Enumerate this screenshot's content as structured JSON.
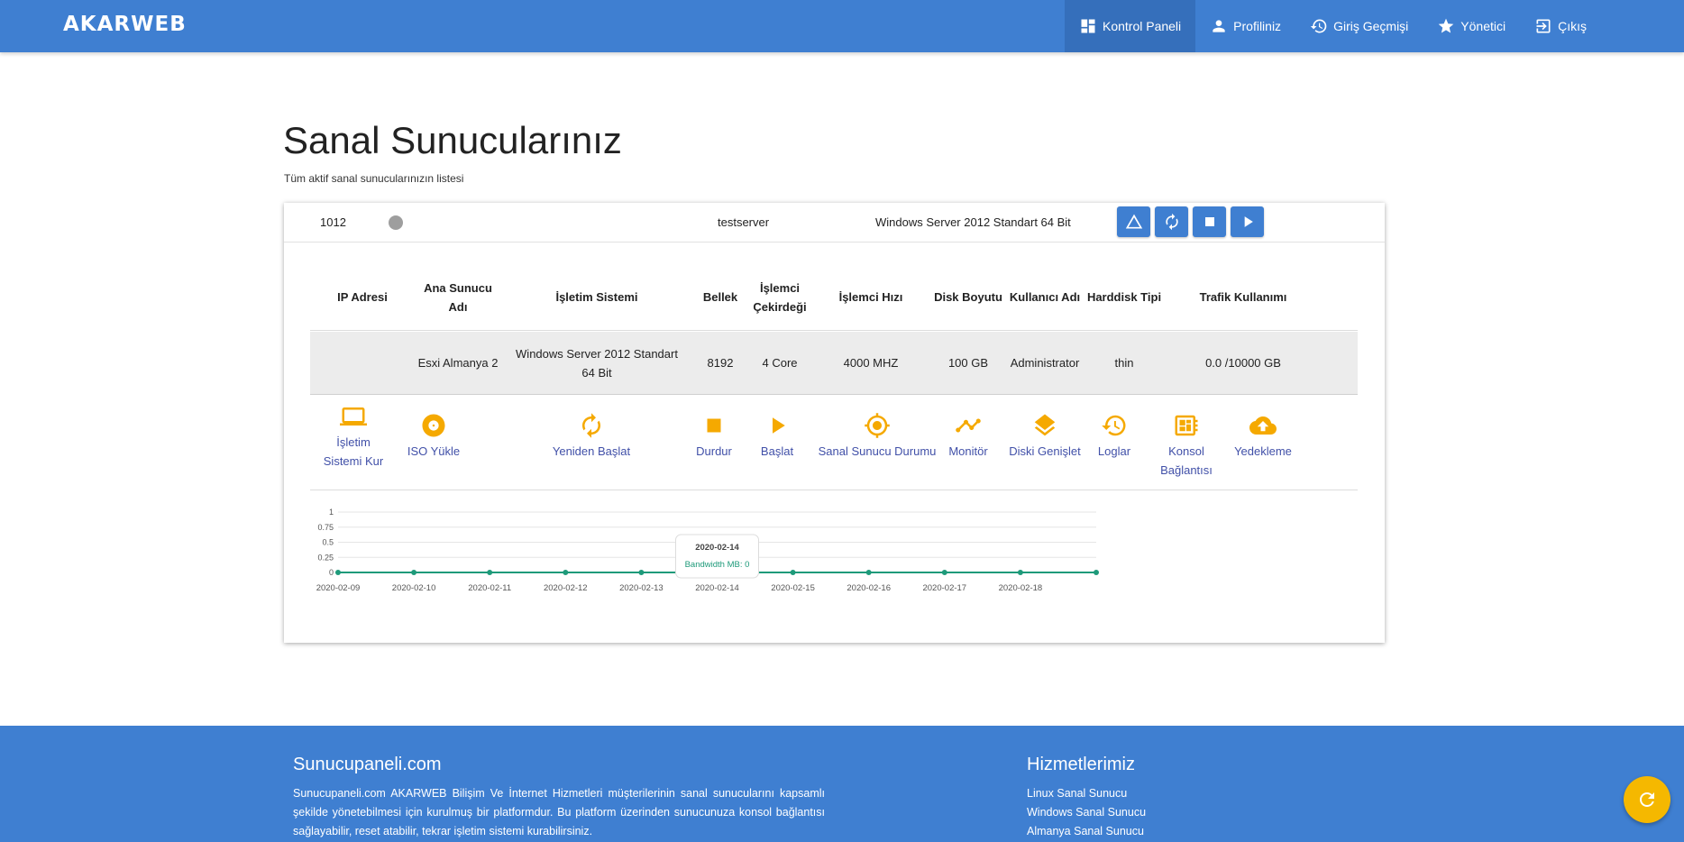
{
  "brand": "AKARWEB",
  "nav": [
    {
      "label": "Kontrol Paneli",
      "icon": "dashboard-icon",
      "active": true
    },
    {
      "label": "Profiliniz",
      "icon": "person-icon"
    },
    {
      "label": "Giriş Geçmişi",
      "icon": "history-icon"
    },
    {
      "label": "Yönetici",
      "icon": "star-icon"
    },
    {
      "label": "Çıkış",
      "icon": "logout-icon"
    }
  ],
  "page": {
    "title": "Sanal Sunucularınız",
    "subtitle": "Tüm aktif sanal sunucularınızın listesi"
  },
  "server": {
    "id": "1012",
    "status_color": "#9e9e9e",
    "name": "testserver",
    "os": "Windows Server 2012 Standart 64 Bit",
    "controls": [
      "warning-icon",
      "restart-icon",
      "stop-icon",
      "play-icon"
    ]
  },
  "table": {
    "headers": [
      "IP Adresi",
      "Ana Sunucu Adı",
      "İşletim Sistemi",
      "Bellek",
      "İşlemci Çekirdeği",
      "İşlemci Hızı",
      "Disk Boyutu",
      "Kullanıcı Adı",
      "Harddisk Tipi",
      "Trafik Kullanımı"
    ],
    "row": [
      "",
      "Esxi Almanya 2",
      "Windows Server 2012 Standart 64 Bit",
      "8192",
      "4 Core",
      "4000 MHZ",
      "100 GB",
      "Administrator",
      "thin",
      "0.0 /10000 GB"
    ]
  },
  "actions": [
    {
      "label": "İşletim Sistemi Kur",
      "icon": "laptop-icon"
    },
    {
      "label": "ISO Yükle",
      "icon": "disc-icon"
    },
    {
      "label": "Yeniden Başlat",
      "icon": "restart-icon"
    },
    {
      "label": "Durdur",
      "icon": "stop-icon"
    },
    {
      "label": "Başlat",
      "icon": "play-icon"
    },
    {
      "label": "Sanal Sunucu Durumu",
      "icon": "target-icon"
    },
    {
      "label": "Monitör",
      "icon": "trend-icon"
    },
    {
      "label": "Diski Genişlet",
      "icon": "layers-icon"
    },
    {
      "label": "Loglar",
      "icon": "history-icon"
    },
    {
      "label": "Konsol Bağlantısı",
      "icon": "console-icon"
    },
    {
      "label": "Yedekleme",
      "icon": "cloud-upload-icon"
    }
  ],
  "chart_data": {
    "type": "line",
    "x": [
      "2020-02-09",
      "2020-02-10",
      "2020-02-11",
      "2020-02-12",
      "2020-02-13",
      "2020-02-14",
      "2020-02-15",
      "2020-02-16",
      "2020-02-17",
      "2020-02-18",
      "2020-02-19"
    ],
    "x_tick_labels": [
      "2020-02-09",
      "2020-02-10",
      "2020-02-11",
      "2020-02-12",
      "2020-02-13",
      "2020-02-14",
      "2020-02-15",
      "2020-02-16",
      "2020-02-17",
      "2020-02-18"
    ],
    "series": [
      {
        "name": "Bandwidth MB",
        "values": [
          0,
          0,
          0,
          0,
          0,
          0,
          0,
          0,
          0,
          0,
          0
        ]
      }
    ],
    "yticks": [
      "0",
      "0.25",
      "0.5",
      "0.75",
      "1"
    ],
    "ylim": [
      0,
      1
    ],
    "grid": true,
    "color": "#1e9a7a",
    "tooltip": {
      "date": "2020-02-14",
      "text": "Bandwidth MB: 0",
      "index": 5
    }
  },
  "footer": {
    "title_left": "Sunucupaneli.com",
    "text": "Sunucupaneli.com AKARWEB Bilişim Ve İnternet Hizmetleri müşterilerinin sanal sunucularını kapsamlı şekilde yönetebilmesi için kurulmuş bir platformdur. Bu platform üzerinden sunucunuza konsol bağlantısı sağlayabilir, reset atabilir, tekrar işletim sistemi kurabilirsiniz.",
    "title_right": "Hizmetlerimiz",
    "links": [
      "Linux Sanal Sunucu",
      "Windows Sanal Sunucu",
      "Almanya Sanal Sunucu"
    ]
  },
  "fab_icon": "refresh-icon"
}
